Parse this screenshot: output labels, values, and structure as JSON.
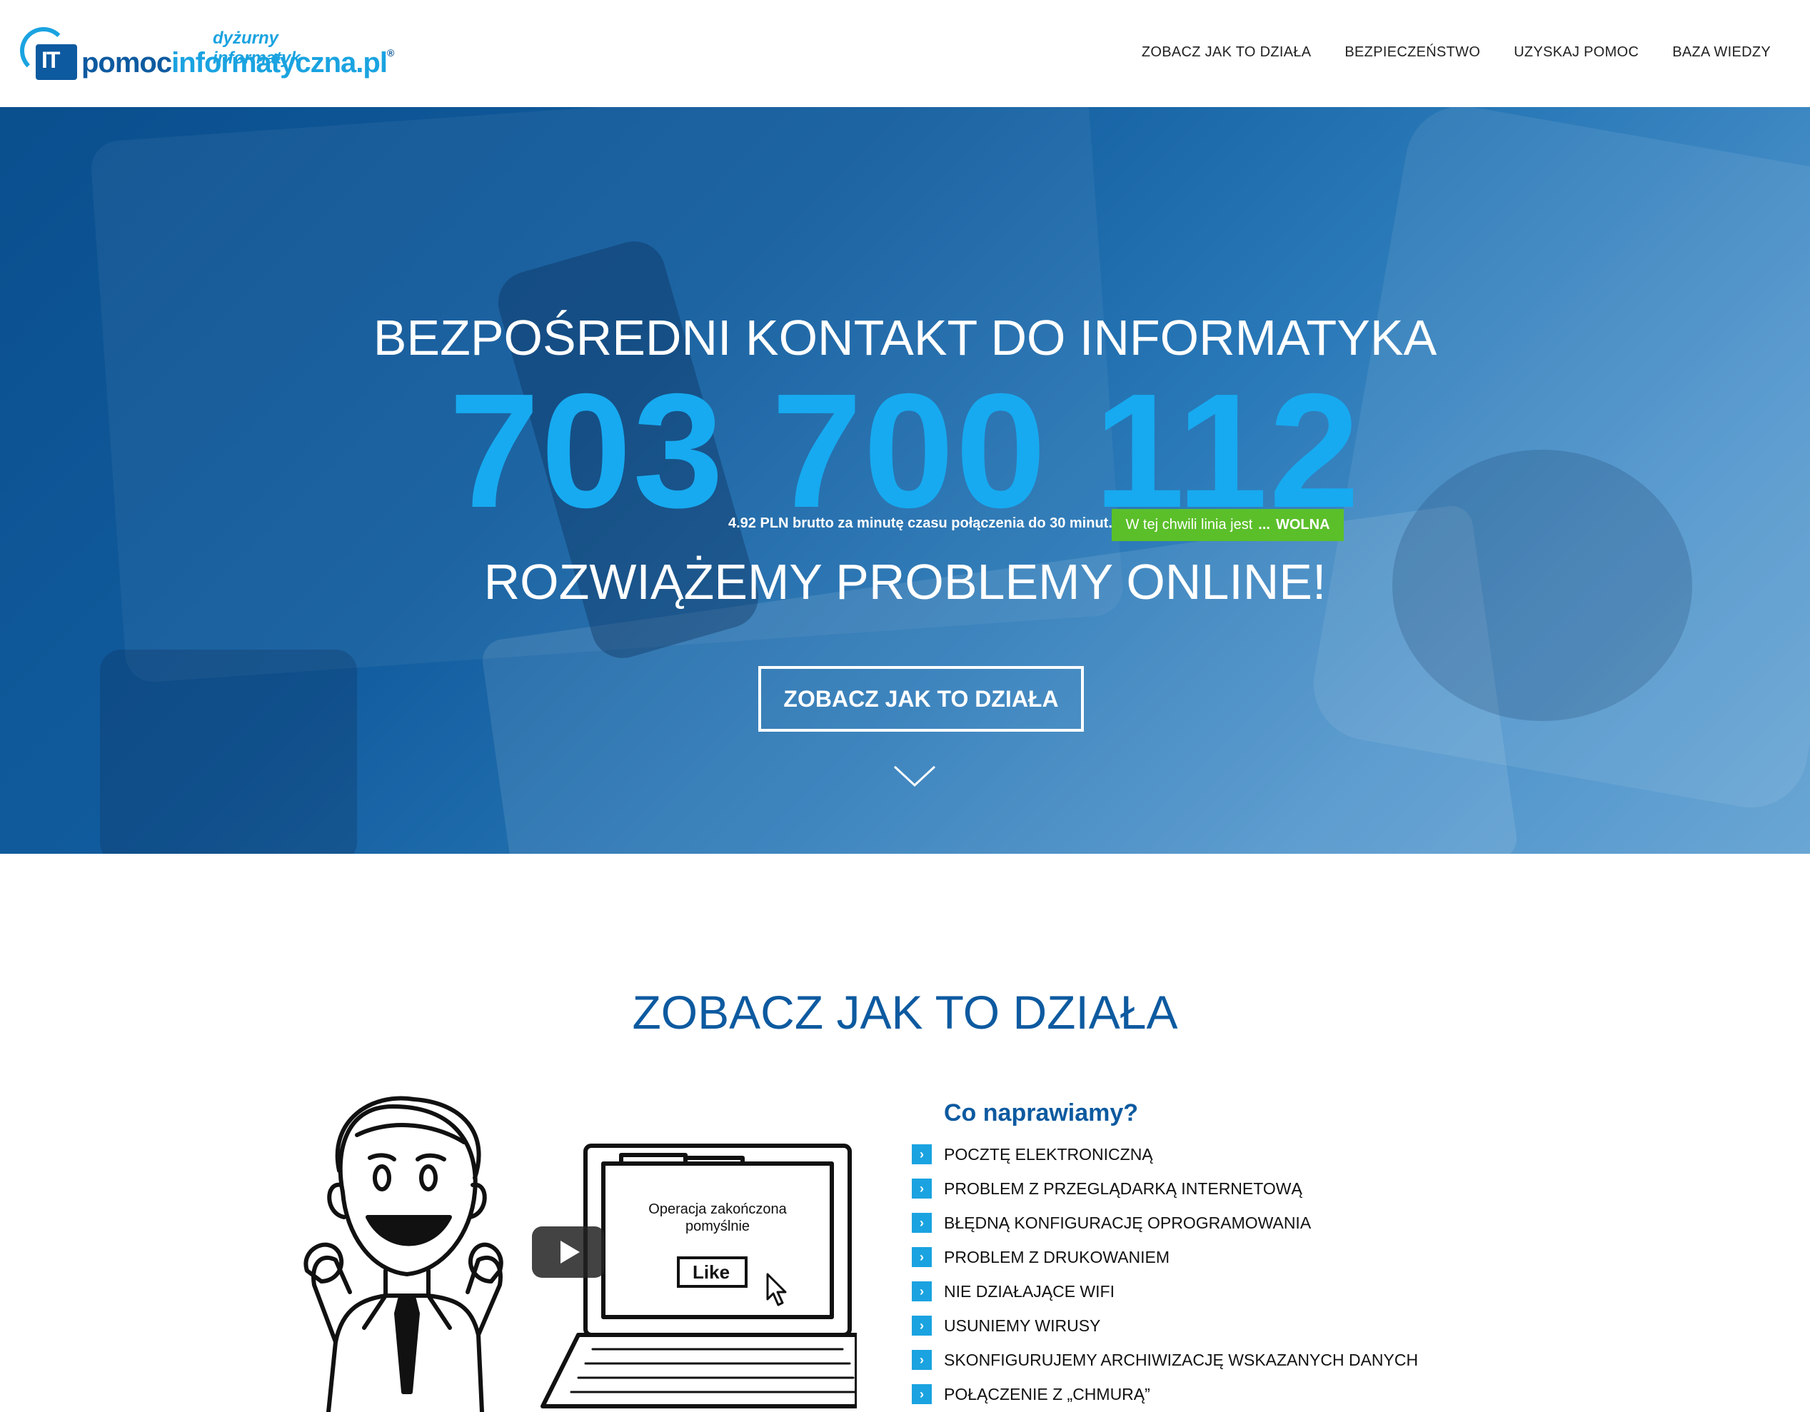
{
  "logo": {
    "subtitle": "dyżurny informatyk",
    "mark": "IT",
    "name_part1": "pomoc",
    "name_part2": "informatyczna.pl",
    "reg": "®"
  },
  "nav": {
    "items": [
      "ZOBACZ JAK TO DZIAŁA",
      "BEZPIECZEŃSTWO",
      "UZYSKAJ POMOC",
      "BAZA WIEDZY"
    ]
  },
  "hero": {
    "title": "BEZPOŚREDNI KONTAKT DO INFORMATYKA",
    "phone": "703 700 112",
    "price_note": "4.92 PLN brutto za minutę czasu połączenia do 30 minut.",
    "line_status_prefix": "W tej chwili linia jest",
    "line_status_dots": "...",
    "line_status_value": "WOLNA",
    "subtitle": "ROZWIĄŻEMY PROBLEMY ONLINE!",
    "cta_label": "ZOBACZ JAK TO DZIAŁA"
  },
  "section": {
    "title": "ZOBACZ JAK TO DZIAŁA"
  },
  "video": {
    "screen_text_line1": "Operacja zakończona",
    "screen_text_line2": "pomyślnie",
    "like_label": "Like"
  },
  "fixes": {
    "title": "Co naprawiamy?",
    "bullet": "›",
    "items": [
      "POCZTĘ ELEKTRONICZNĄ",
      "PROBLEM Z PRZEGLĄDARKĄ INTERNETOWĄ",
      "BŁĘDNĄ KONFIGURACJĘ OPROGRAMOWANIA",
      "PROBLEM Z DRUKOWANIEM",
      "NIE DZIAŁAJĄCE WIFI",
      "USUNIEMY WIRUSY",
      "SKONFIGURUJEMY ARCHIWIZACJĘ WSKAZANYCH DANYCH",
      "POŁĄCZENIE Z „CHMURĄ”"
    ]
  },
  "colors": {
    "brand_dark": "#0d5aa0",
    "brand_light": "#1aa3e0",
    "status_green": "#5bbf2a"
  }
}
